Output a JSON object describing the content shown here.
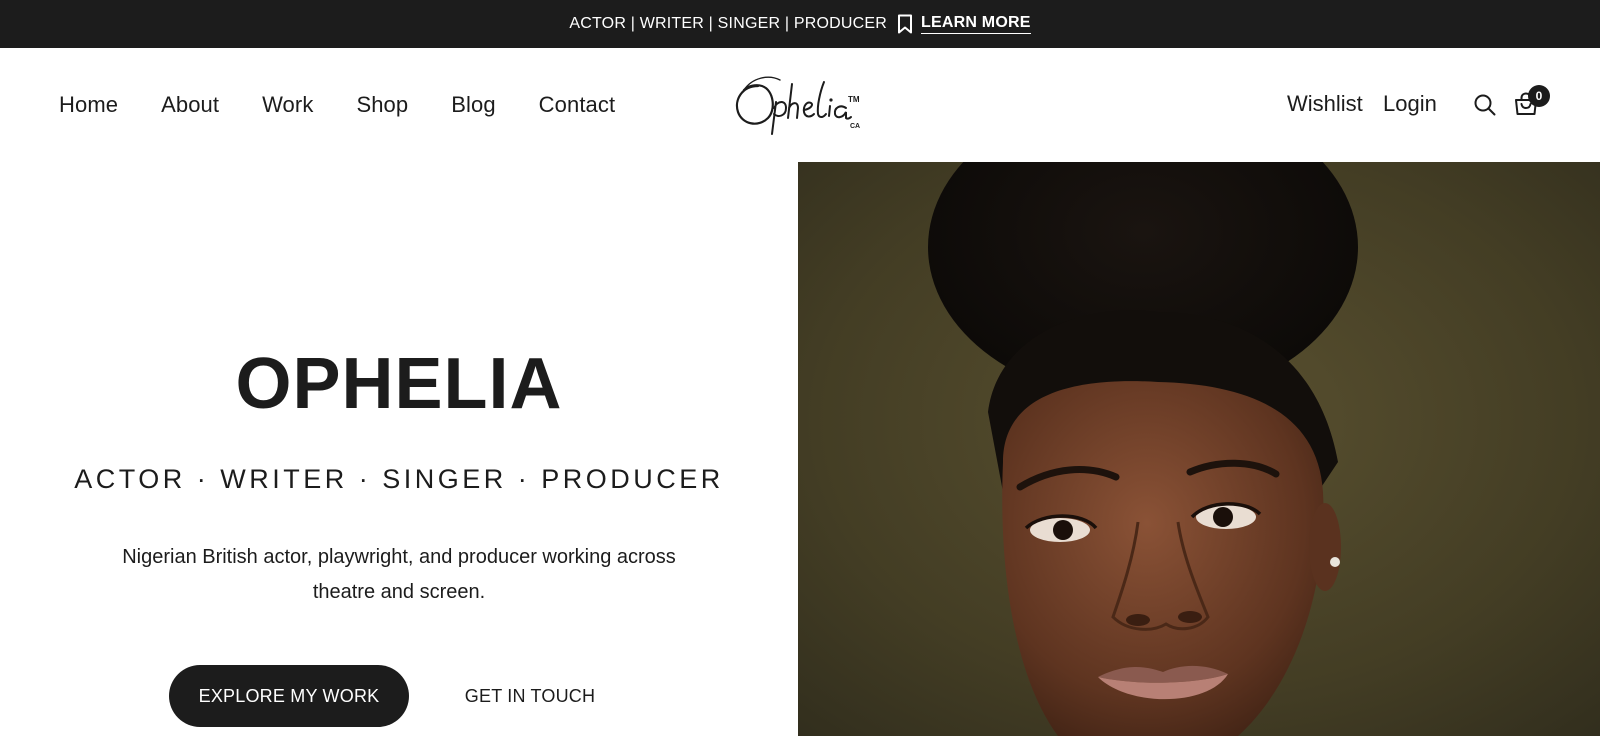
{
  "announcement": {
    "text": "ACTOR | WRITER | SINGER | PRODUCER",
    "link_label": "LEARN MORE"
  },
  "nav": {
    "items": [
      {
        "label": "Home"
      },
      {
        "label": "About"
      },
      {
        "label": "Work"
      },
      {
        "label": "Shop"
      },
      {
        "label": "Blog"
      },
      {
        "label": "Contact"
      }
    ]
  },
  "logo": {
    "wordmark": "Ophelia",
    "tm": "TM",
    "suffix": "CA"
  },
  "account": {
    "wishlist_label": "Wishlist",
    "login_label": "Login",
    "cart_count": "0"
  },
  "hero": {
    "title": "OPHELIA",
    "subtitle": "ACTOR · WRITER · SINGER · PRODUCER",
    "description": "Nigerian British actor, playwright, and producer working across theatre and screen.",
    "primary_button": "EXPLORE MY WORK",
    "secondary_button": "GET IN TOUCH"
  },
  "colors": {
    "dark": "#1c1c1c",
    "background": "#ffffff",
    "photo_backdrop": "#3f3a24"
  },
  "icons": [
    "bookmark-icon",
    "search-icon",
    "cart-icon"
  ]
}
